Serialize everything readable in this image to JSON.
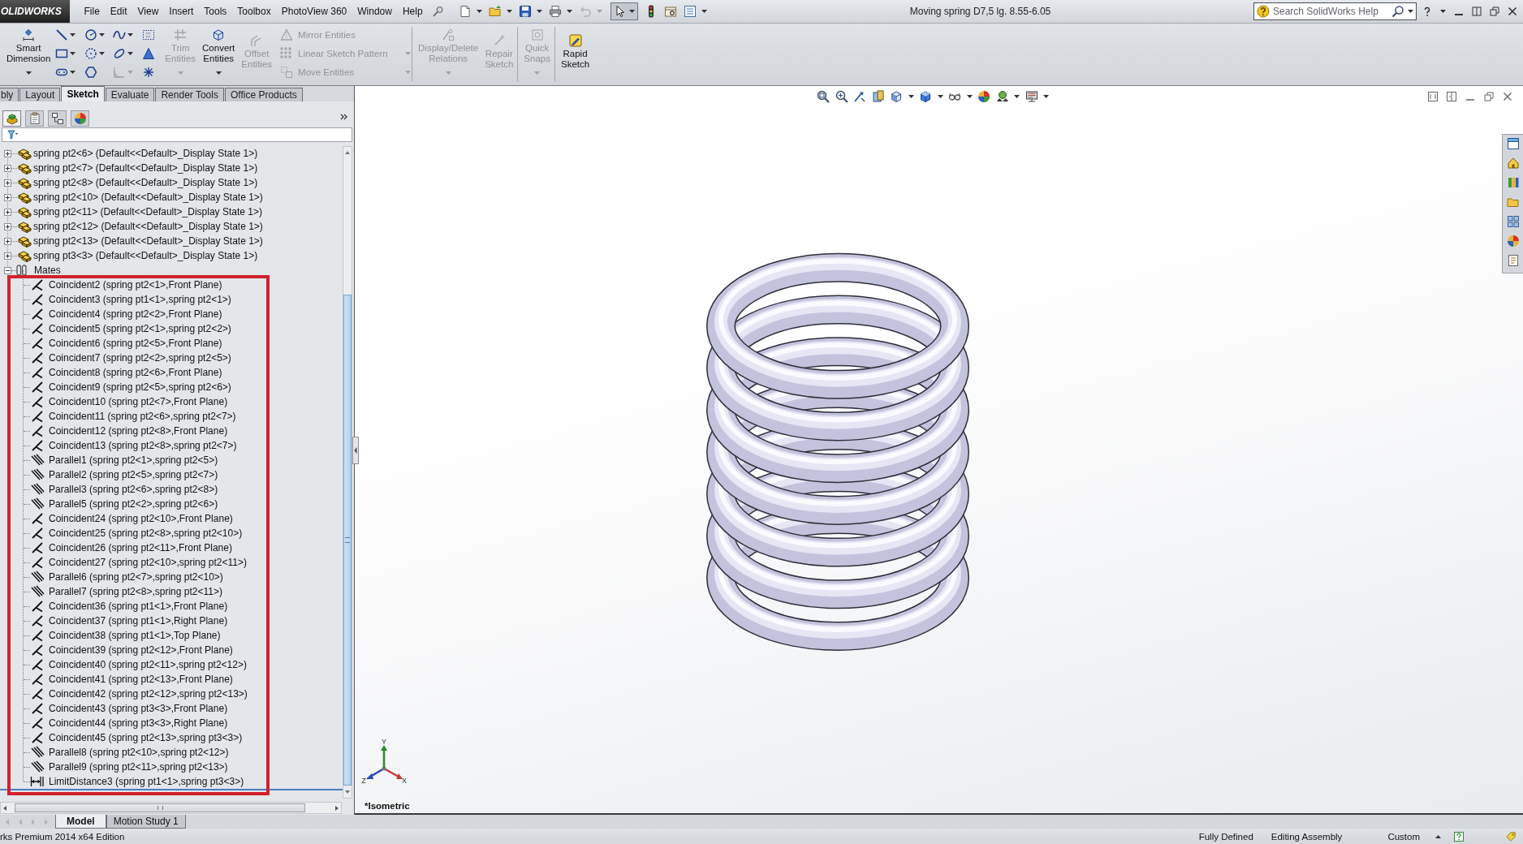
{
  "title_bar": {
    "logo": "OLIDWORKS",
    "menu": [
      "File",
      "Edit",
      "View",
      "Insert",
      "Tools",
      "Toolbox",
      "PhotoView 360",
      "Window",
      "Help"
    ],
    "document_title": "Moving spring D7,5 lg. 8.55-6.05",
    "help_search": {
      "placeholder": "Search SolidWorks Help"
    }
  },
  "command_manager": {
    "groups": [
      [
        {
          "kind": "large",
          "label": "Smart Dimension",
          "disabled": false,
          "dropdown": true
        },
        {
          "kind": "grid",
          "tools": [
            {
              "dropdown": true,
              "disabled": false
            },
            {
              "dropdown": true,
              "disabled": false
            },
            {
              "dropdown": true,
              "disabled": false
            },
            {
              "dropdown": false,
              "disabled": false
            },
            {
              "dropdown": true,
              "disabled": false
            },
            {
              "dropdown": true,
              "disabled": false
            },
            {
              "dropdown": true,
              "disabled": false
            },
            {
              "dropdown": false,
              "disabled": false
            },
            {
              "dropdown": true,
              "disabled": false
            },
            {
              "dropdown": false,
              "disabled": false
            },
            {
              "dropdown": true,
              "disabled": true
            },
            {
              "dropdown": false,
              "disabled": false
            }
          ]
        },
        {
          "kind": "large",
          "label": "Trim Entities",
          "disabled": true,
          "dropdown": true
        },
        {
          "kind": "large",
          "label": "Convert Entities",
          "disabled": false,
          "dropdown": true
        },
        {
          "kind": "large",
          "label": "Offset Entities",
          "disabled": true,
          "dropdown": false
        },
        {
          "kind": "stack",
          "items": [
            {
              "label": "Mirror Entities",
              "disabled": true,
              "dropdown": false
            },
            {
              "label": "Linear Sketch Pattern",
              "disabled": true,
              "dropdown": true
            },
            {
              "label": "Move Entities",
              "disabled": true,
              "dropdown": true
            }
          ]
        }
      ],
      [
        {
          "kind": "large",
          "label": "Display/Delete Relations",
          "disabled": true,
          "dropdown": true
        },
        {
          "kind": "large",
          "label": "Repair Sketch",
          "disabled": true,
          "dropdown": false
        }
      ],
      [
        {
          "kind": "large",
          "label": "Quick Snaps",
          "disabled": true,
          "dropdown": true
        }
      ],
      [
        {
          "kind": "large",
          "label": "Rapid Sketch",
          "disabled": false,
          "dropdown": false
        }
      ]
    ]
  },
  "tabs": [
    {
      "label": "bly",
      "selected": false
    },
    {
      "label": "Layout",
      "selected": false
    },
    {
      "label": "Sketch",
      "selected": true
    },
    {
      "label": "Evaluate",
      "selected": false
    },
    {
      "label": "Render Tools",
      "selected": false
    },
    {
      "label": "Office Products",
      "selected": false
    }
  ],
  "feature_manager": {
    "panel_tabs": [
      {
        "selected": true
      },
      {
        "selected": false
      },
      {
        "selected": false
      },
      {
        "selected": false
      }
    ],
    "tree": [
      {
        "kind": "part",
        "label": "spring pt2<6> (Default<<Default>_Display State 1>)",
        "expanded": false
      },
      {
        "kind": "part",
        "label": "spring pt2<7> (Default<<Default>_Display State 1>)",
        "expanded": false
      },
      {
        "kind": "part",
        "label": "spring pt2<8> (Default<<Default>_Display State 1>)",
        "expanded": false
      },
      {
        "kind": "part",
        "label": "spring pt2<10> (Default<<Default>_Display State 1>)",
        "expanded": false
      },
      {
        "kind": "part",
        "label": "spring pt2<11> (Default<<Default>_Display State 1>)",
        "expanded": false
      },
      {
        "kind": "part",
        "label": "spring pt2<12> (Default<<Default>_Display State 1>)",
        "expanded": false
      },
      {
        "kind": "part",
        "label": "spring pt2<13> (Default<<Default>_Display State 1>)",
        "expanded": false
      },
      {
        "kind": "part",
        "label": "spring pt3<3> (Default<<Default>_Display State 1>)",
        "expanded": false
      },
      {
        "kind": "mates",
        "label": "Mates",
        "expanded": true,
        "children": [
          {
            "kind": "coincident",
            "label": "Coincident2 (spring pt2<1>,Front Plane)"
          },
          {
            "kind": "coincident",
            "label": "Coincident3 (spring pt1<1>,spring pt2<1>)"
          },
          {
            "kind": "coincident",
            "label": "Coincident4 (spring pt2<2>,Front Plane)"
          },
          {
            "kind": "coincident",
            "label": "Coincident5 (spring pt2<1>,spring pt2<2>)"
          },
          {
            "kind": "coincident",
            "label": "Coincident6 (spring pt2<5>,Front Plane)"
          },
          {
            "kind": "coincident",
            "label": "Coincident7 (spring pt2<2>,spring pt2<5>)"
          },
          {
            "kind": "coincident",
            "label": "Coincident8 (spring pt2<6>,Front Plane)"
          },
          {
            "kind": "coincident",
            "label": "Coincident9 (spring pt2<5>,spring pt2<6>)"
          },
          {
            "kind": "coincident",
            "label": "Coincident10 (spring pt2<7>,Front Plane)"
          },
          {
            "kind": "coincident",
            "label": "Coincident11 (spring pt2<6>,spring pt2<7>)"
          },
          {
            "kind": "coincident",
            "label": "Coincident12 (spring pt2<8>,Front Plane)"
          },
          {
            "kind": "coincident",
            "label": "Coincident13 (spring pt2<8>,spring pt2<7>)"
          },
          {
            "kind": "parallel",
            "label": "Parallel1 (spring pt2<1>,spring pt2<5>)"
          },
          {
            "kind": "parallel",
            "label": "Parallel2 (spring pt2<5>,spring pt2<7>)"
          },
          {
            "kind": "parallel",
            "label": "Parallel3 (spring pt2<6>,spring pt2<8>)"
          },
          {
            "kind": "parallel",
            "label": "Parallel5 (spring pt2<2>,spring pt2<6>)"
          },
          {
            "kind": "coincident",
            "label": "Coincident24 (spring pt2<10>,Front Plane)"
          },
          {
            "kind": "coincident",
            "label": "Coincident25 (spring pt2<8>,spring pt2<10>)"
          },
          {
            "kind": "coincident",
            "label": "Coincident26 (spring pt2<11>,Front Plane)"
          },
          {
            "kind": "coincident",
            "label": "Coincident27 (spring pt2<10>,spring pt2<11>)"
          },
          {
            "kind": "parallel",
            "label": "Parallel6 (spring pt2<7>,spring pt2<10>)"
          },
          {
            "kind": "parallel",
            "label": "Parallel7 (spring pt2<8>,spring pt2<11>)"
          },
          {
            "kind": "coincident",
            "label": "Coincident36 (spring pt1<1>,Front Plane)"
          },
          {
            "kind": "coincident",
            "label": "Coincident37 (spring pt1<1>,Right Plane)"
          },
          {
            "kind": "coincident",
            "label": "Coincident38 (spring pt1<1>,Top Plane)"
          },
          {
            "kind": "coincident",
            "label": "Coincident39 (spring pt2<12>,Front Plane)"
          },
          {
            "kind": "coincident",
            "label": "Coincident40 (spring pt2<11>,spring pt2<12>)"
          },
          {
            "kind": "coincident",
            "label": "Coincident41 (spring pt2<13>,Front Plane)"
          },
          {
            "kind": "coincident",
            "label": "Coincident42 (spring pt2<12>,spring pt2<13>)"
          },
          {
            "kind": "coincident",
            "label": "Coincident43 (spring pt3<3>,Front Plane)"
          },
          {
            "kind": "coincident",
            "label": "Coincident44 (spring pt3<3>,Right Plane)"
          },
          {
            "kind": "coincident",
            "label": "Coincident45 (spring pt2<13>,spring pt3<3>)"
          },
          {
            "kind": "parallel",
            "label": "Parallel8 (spring pt2<10>,spring pt2<12>)"
          },
          {
            "kind": "parallel",
            "label": "Parallel9 (spring pt2<11>,spring pt2<13>)"
          },
          {
            "kind": "limit_distance",
            "label": "LimitDistance3 (spring pt1<1>,spring pt3<3>)"
          }
        ]
      }
    ]
  },
  "viewport": {
    "view_name": "*Isometric",
    "triad": [
      {
        "label": "Y"
      },
      {
        "label": "Z"
      },
      {
        "label": "X"
      }
    ]
  },
  "bottom_tabs": [
    {
      "label": "Model",
      "selected": true
    },
    {
      "label": "Motion Study 1",
      "selected": false
    }
  ],
  "status_bar": {
    "edition": "rks Premium 2014 x64 Edition",
    "fields": [
      "Fully Defined",
      "Editing Assembly",
      "Custom"
    ]
  }
}
